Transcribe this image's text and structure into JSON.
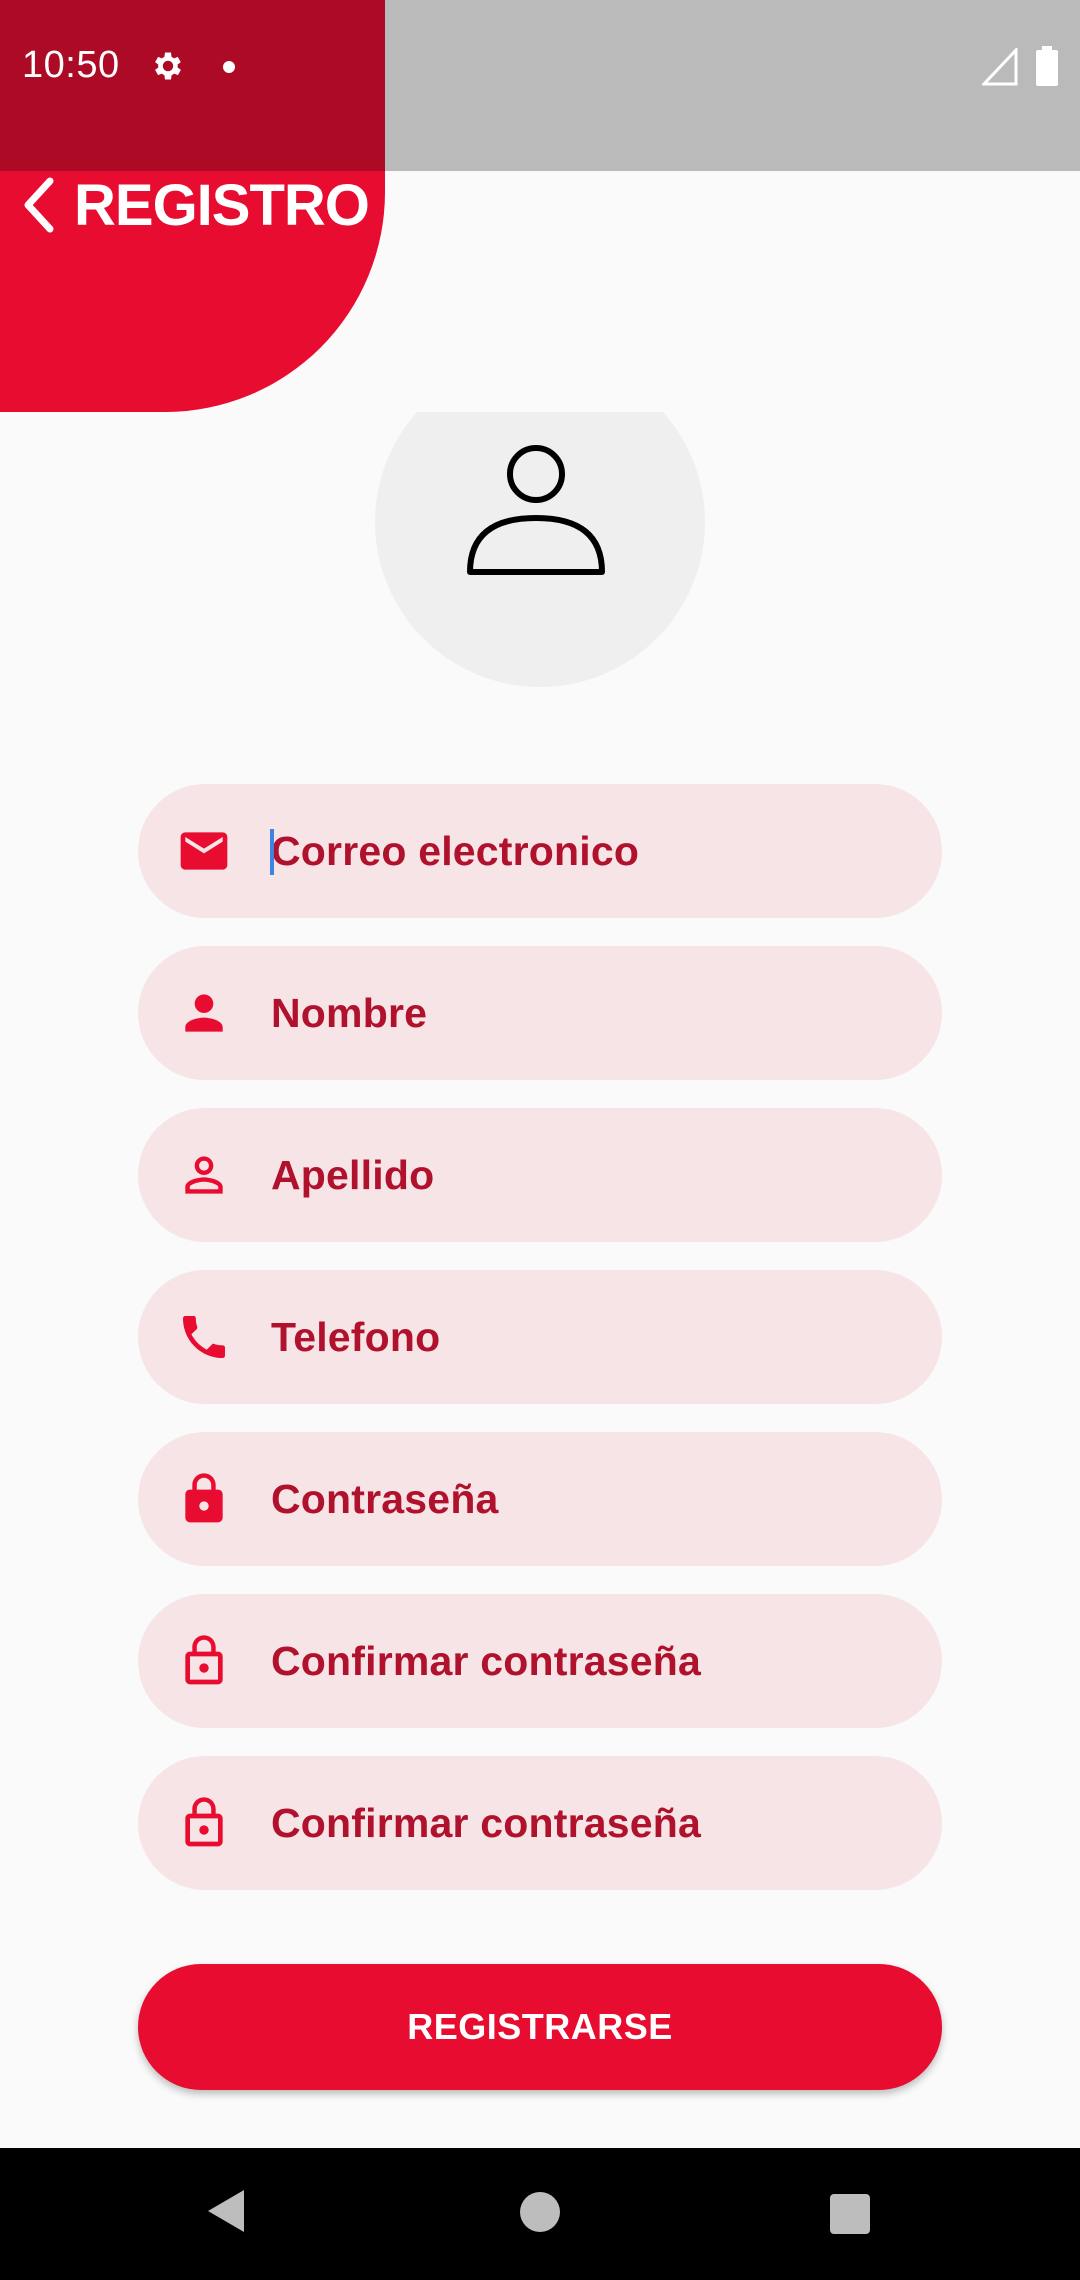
{
  "status_bar": {
    "time": "10:50"
  },
  "header": {
    "title": "REGISTRO"
  },
  "form": {
    "fields": [
      {
        "placeholder": "Correo electronico",
        "icon": "email-icon"
      },
      {
        "placeholder": "Nombre",
        "icon": "person-filled-icon"
      },
      {
        "placeholder": "Apellido",
        "icon": "person-outline-icon"
      },
      {
        "placeholder": "Telefono",
        "icon": "phone-icon"
      },
      {
        "placeholder": "Contraseña",
        "icon": "lock-filled-icon"
      },
      {
        "placeholder": "Confirmar contraseña",
        "icon": "lock-outline-icon"
      },
      {
        "placeholder": "Confirmar contraseña",
        "icon": "lock-outline-icon"
      }
    ],
    "submit_label": "REGISTRARSE"
  },
  "colors": {
    "primary": "#e80c31",
    "primary_dark": "#ad0a26",
    "field_bg": "#f7e4e6",
    "field_text": "#b0112c"
  }
}
